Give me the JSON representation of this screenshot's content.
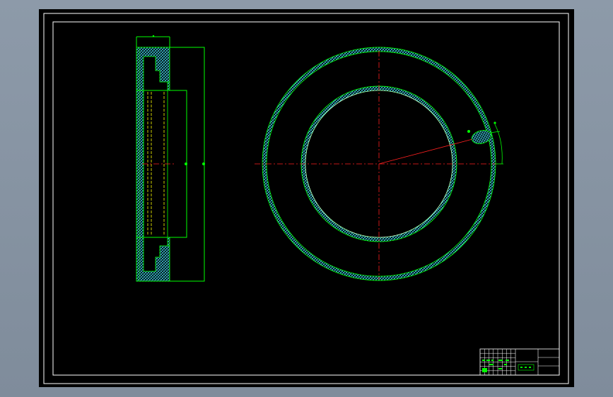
{
  "drawing": {
    "background_color": "#000000",
    "frame_color": "#ffffff",
    "outline_color": "#00ff00",
    "centerline_color": "#ff2020",
    "hatch_color": "#3fd3e8",
    "hidden_line_color": "#ffff00"
  },
  "views": [
    {
      "name": "section-view",
      "type": "side-section"
    },
    {
      "name": "front-view",
      "type": "ring"
    }
  ],
  "title_block": {
    "columns": 8,
    "rows": 6,
    "text": []
  }
}
